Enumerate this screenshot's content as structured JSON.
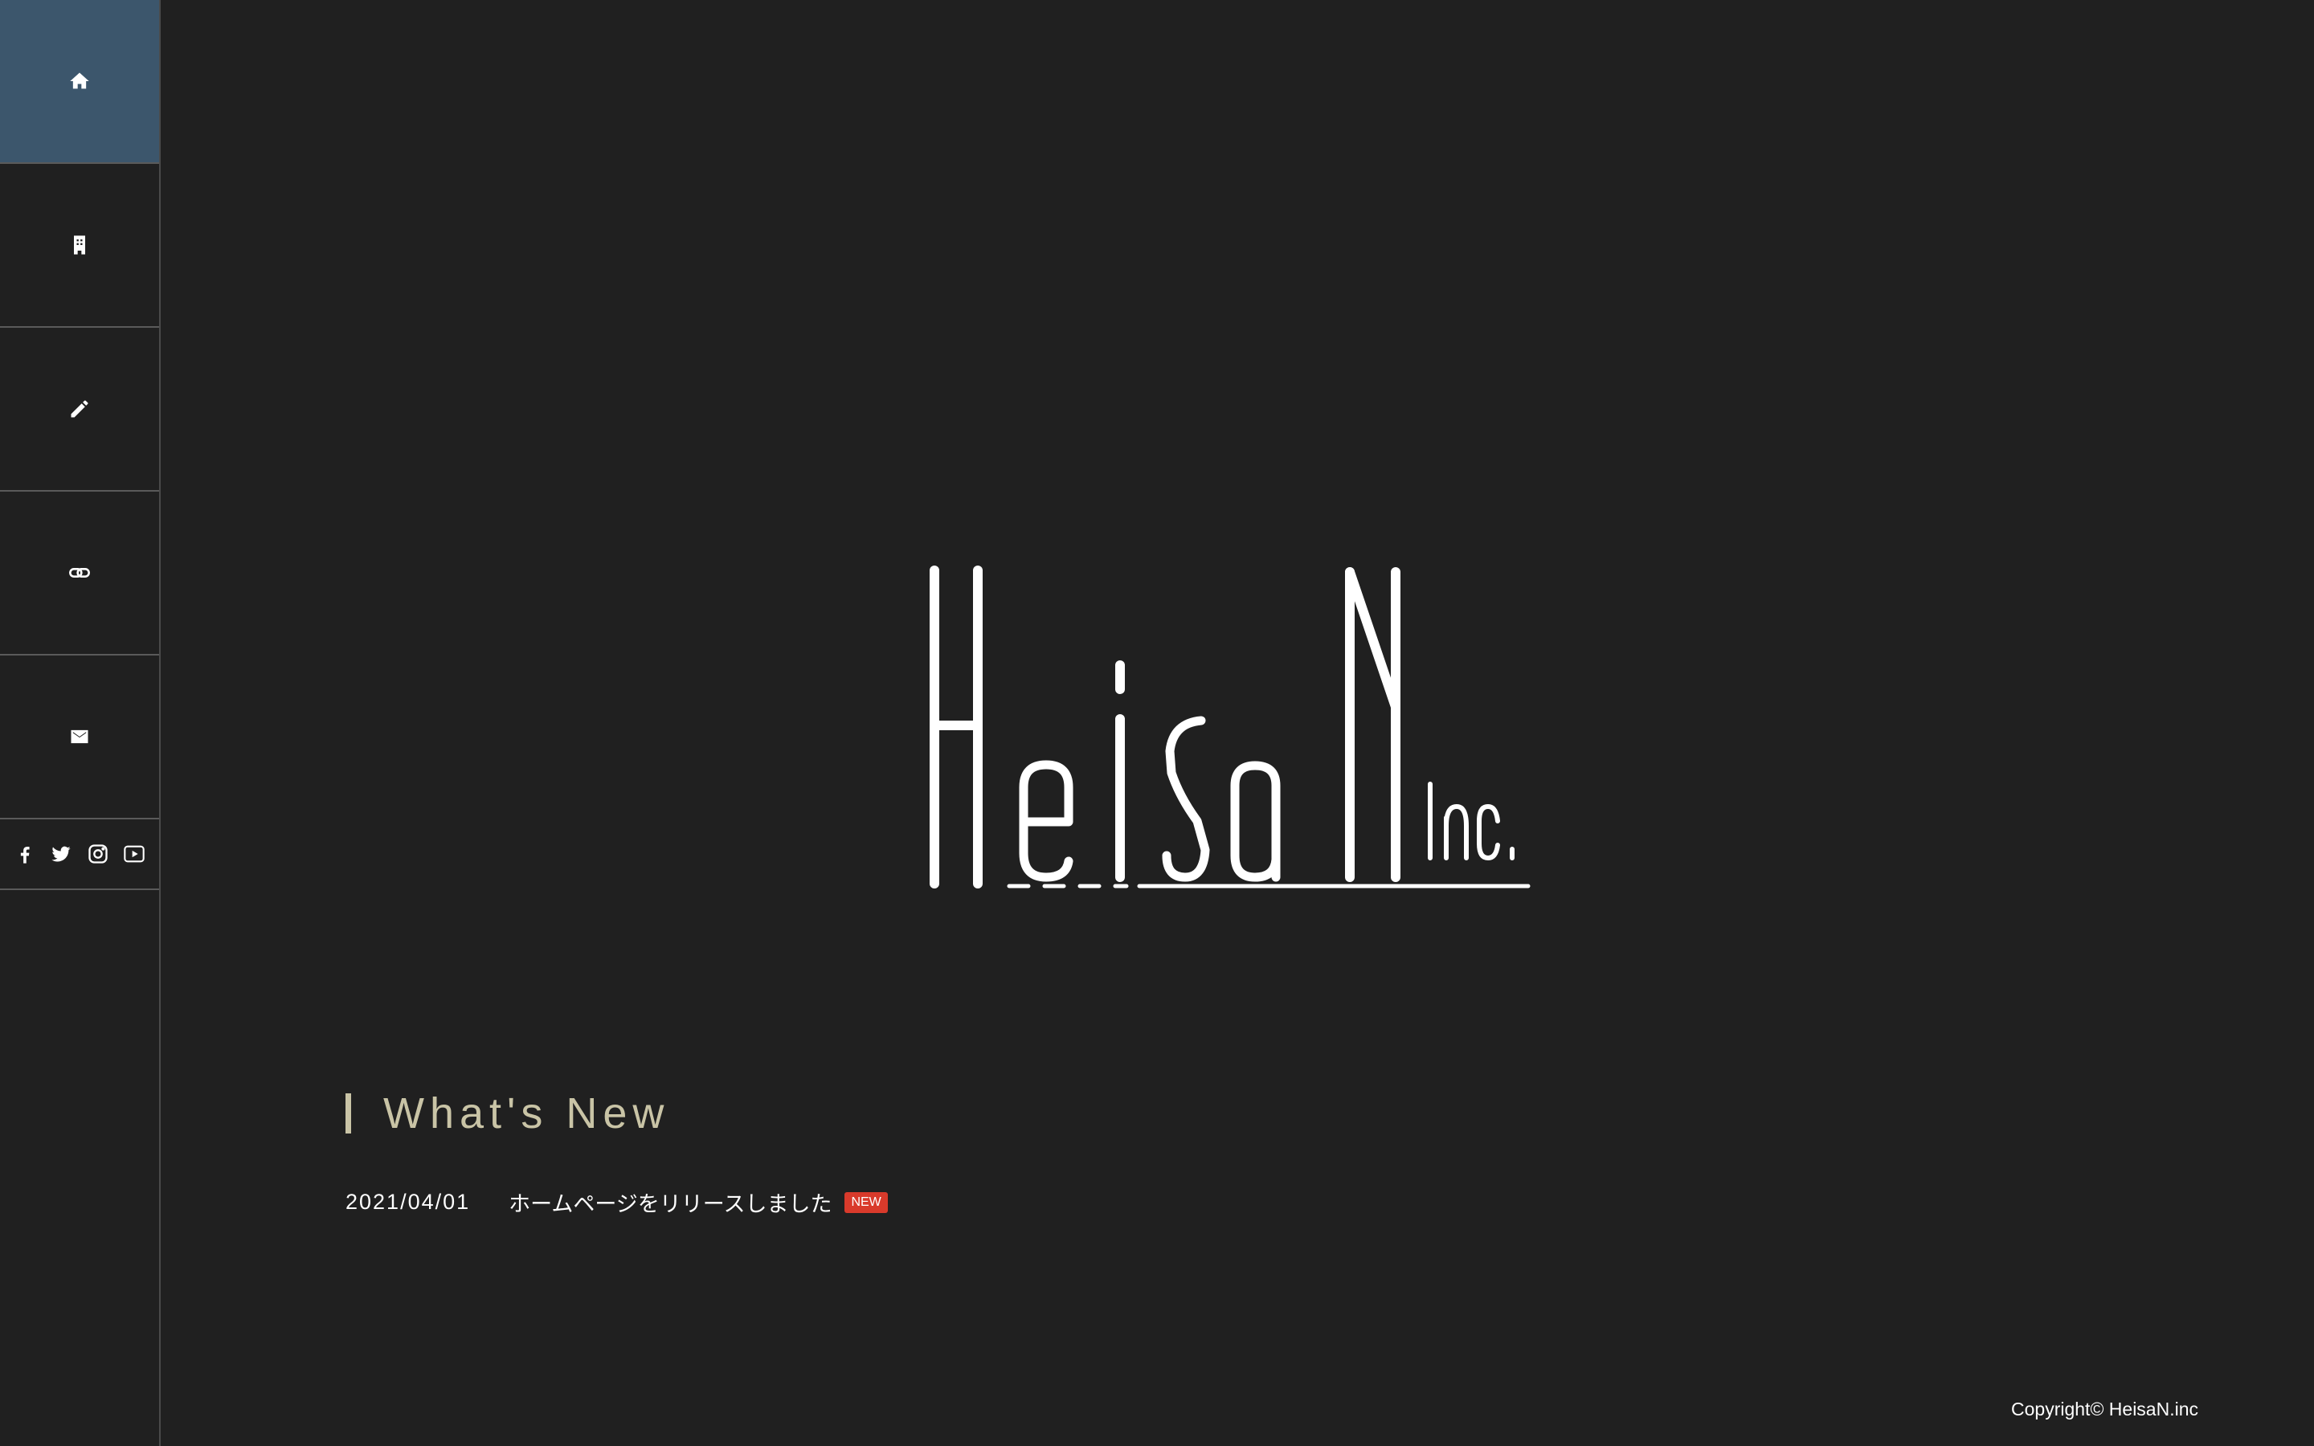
{
  "sidebar": {
    "items": [
      {
        "icon": "home-icon",
        "active": true
      },
      {
        "icon": "building-icon",
        "active": false
      },
      {
        "icon": "pencil-icon",
        "active": false
      },
      {
        "icon": "link-icon",
        "active": false
      },
      {
        "icon": "mail-icon",
        "active": false
      }
    ],
    "social": [
      "facebook-icon",
      "twitter-icon",
      "instagram-icon",
      "youtube-icon"
    ]
  },
  "logo": {
    "main": "HeisaN",
    "suffix": "Inc."
  },
  "news": {
    "title": "What's New",
    "items": [
      {
        "date": "2021/04/01",
        "text": "ホームページをリリースしました",
        "badge": "NEW"
      }
    ]
  },
  "footer": {
    "copyright": "Copyright© HeisaN.inc"
  },
  "colors": {
    "background": "#202020",
    "active_nav": "#3c566c",
    "accent": "#c9c4a6",
    "badge": "#d93a2b"
  }
}
